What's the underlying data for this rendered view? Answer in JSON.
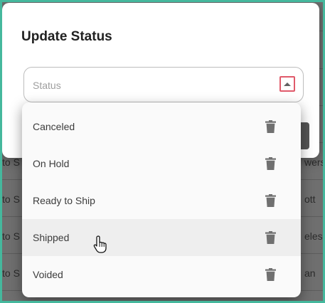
{
  "dialog": {
    "title": "Update Status",
    "select": {
      "placeholder": "Status",
      "toggle_icon": "arrow-up-icon"
    }
  },
  "status_menu": {
    "options": [
      {
        "label": "Canceled",
        "icon": "trash-icon"
      },
      {
        "label": "On Hold",
        "icon": "trash-icon"
      },
      {
        "label": "Ready to Ship",
        "icon": "trash-icon"
      },
      {
        "label": "Shipped",
        "icon": "trash-icon",
        "hovered": true
      },
      {
        "label": "Voided",
        "icon": "trash-icon"
      }
    ]
  },
  "background_rows": [
    {
      "left": "to S",
      "right": "wers"
    },
    {
      "left": "to S",
      "right": "ott"
    },
    {
      "left": "to S",
      "right": "eles"
    },
    {
      "left": "to S",
      "right": "an"
    }
  ],
  "colors": {
    "frame_border": "#45b89d",
    "toggle_highlight": "#e05a6a",
    "backdrop": "#6f6f6f"
  }
}
